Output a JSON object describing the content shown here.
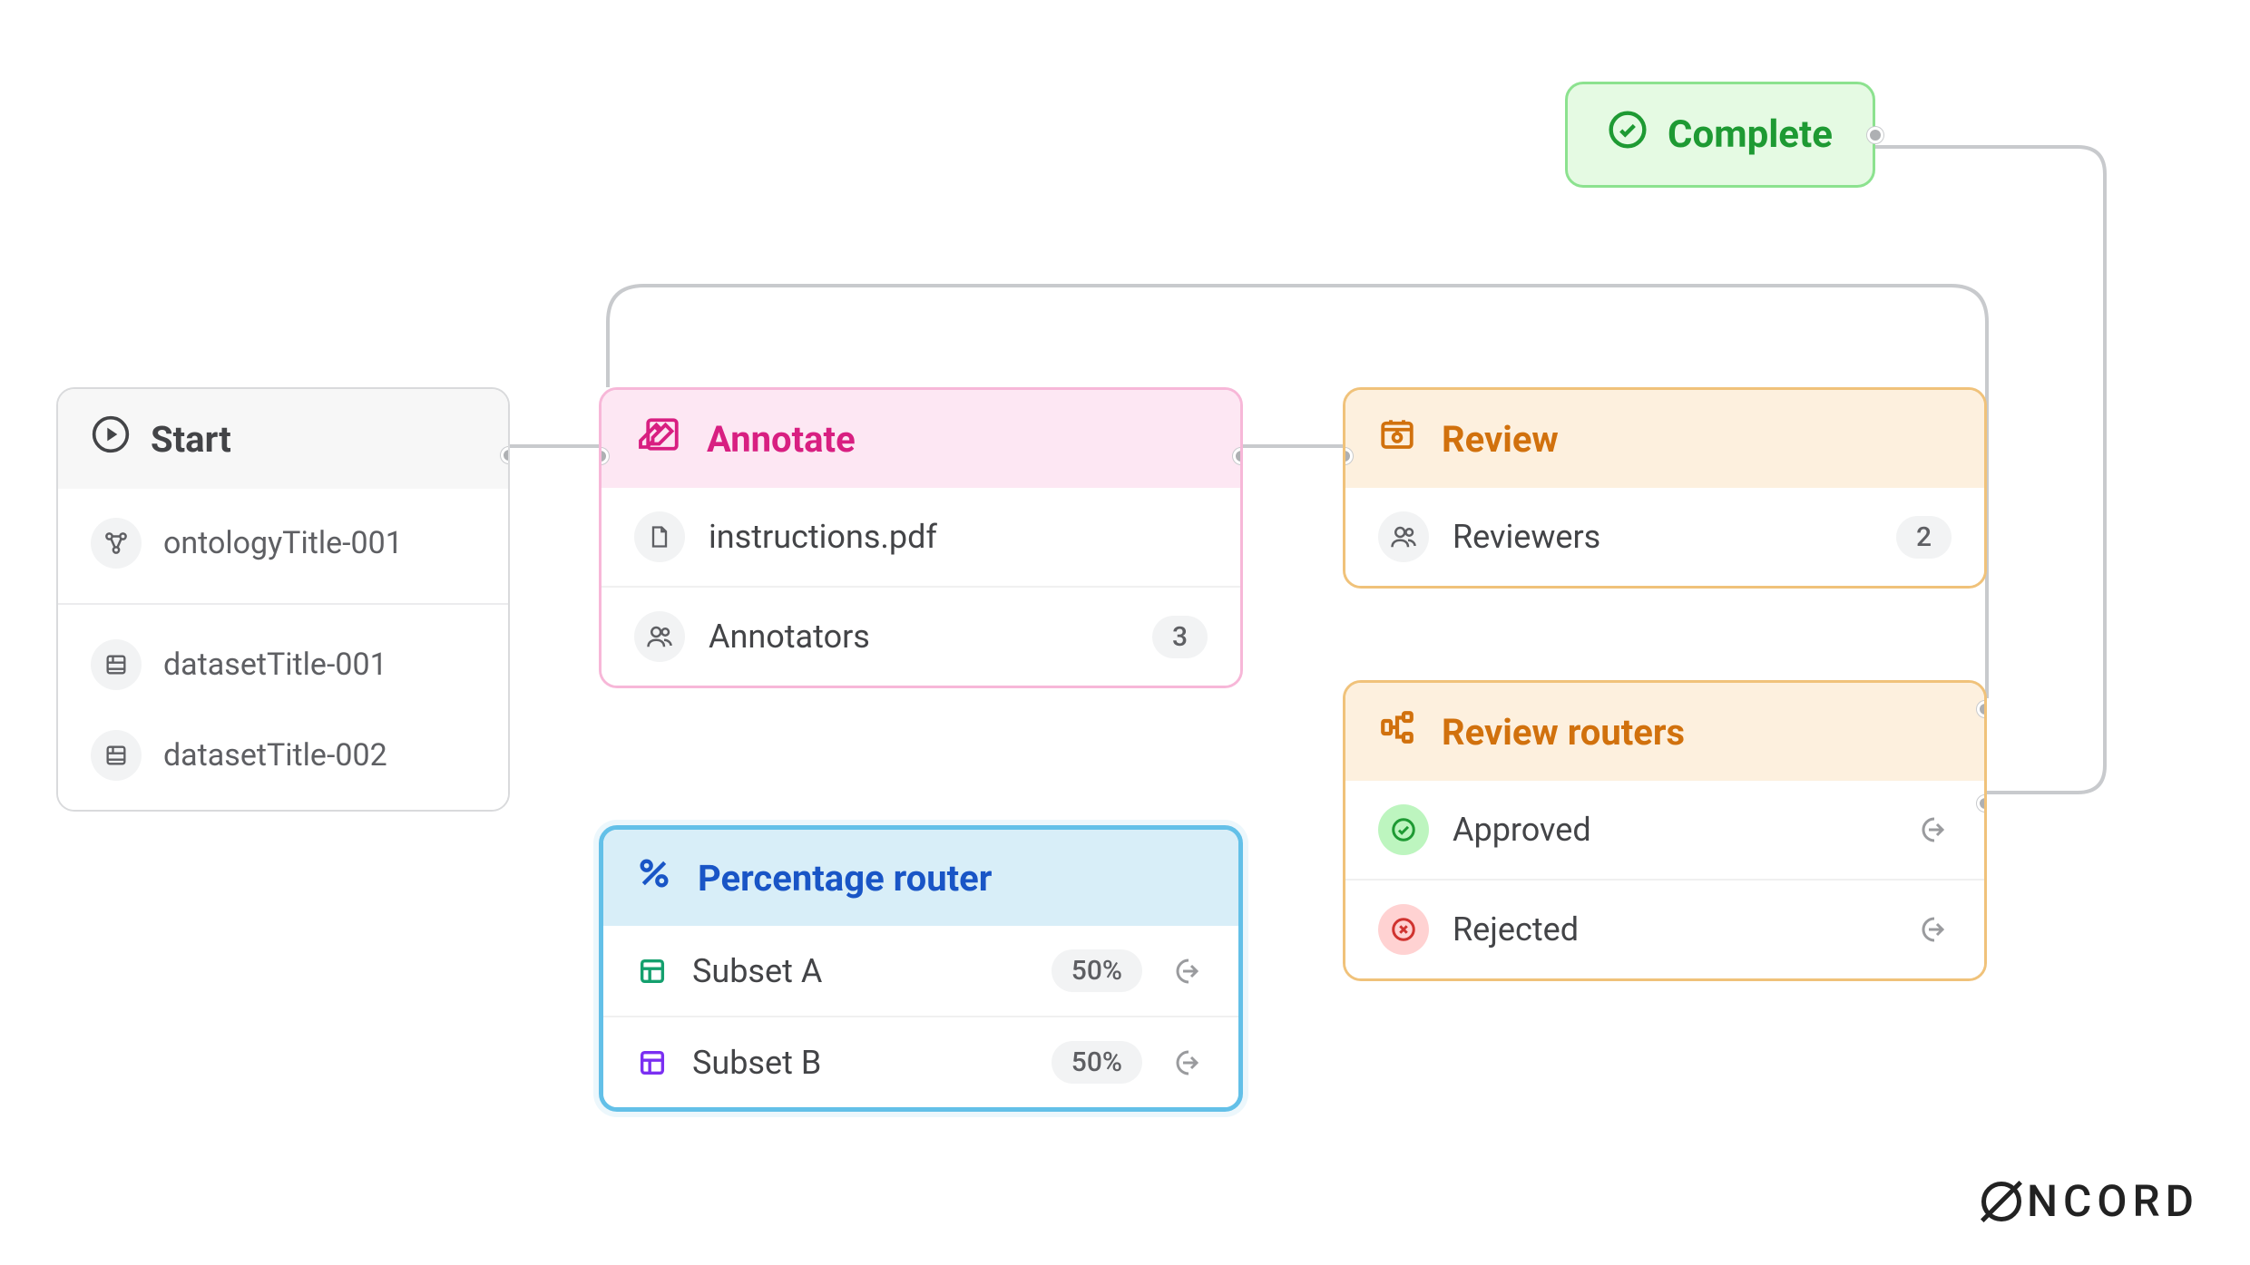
{
  "brand": "NCORD",
  "complete": {
    "label": "Complete"
  },
  "start": {
    "title": "Start",
    "ontology": "ontologyTitle-001",
    "datasets": [
      "datasetTitle-001",
      "datasetTitle-002"
    ]
  },
  "annotate": {
    "title": "Annotate",
    "instructions_label": "instructions.pdf",
    "annotators_label": "Annotators",
    "annotators_count": "3"
  },
  "review": {
    "title": "Review",
    "reviewers_label": "Reviewers",
    "reviewers_count": "2"
  },
  "percent_router": {
    "title": "Percentage router",
    "subsets": [
      {
        "label": "Subset A",
        "pct": "50%",
        "color": "#14a06e"
      },
      {
        "label": "Subset B",
        "pct": "50%",
        "color": "#7b2ff2"
      }
    ]
  },
  "review_routers": {
    "title": "Review routers",
    "routes": [
      {
        "label": "Approved",
        "status": "approved"
      },
      {
        "label": "Rejected",
        "status": "rejected"
      }
    ]
  }
}
